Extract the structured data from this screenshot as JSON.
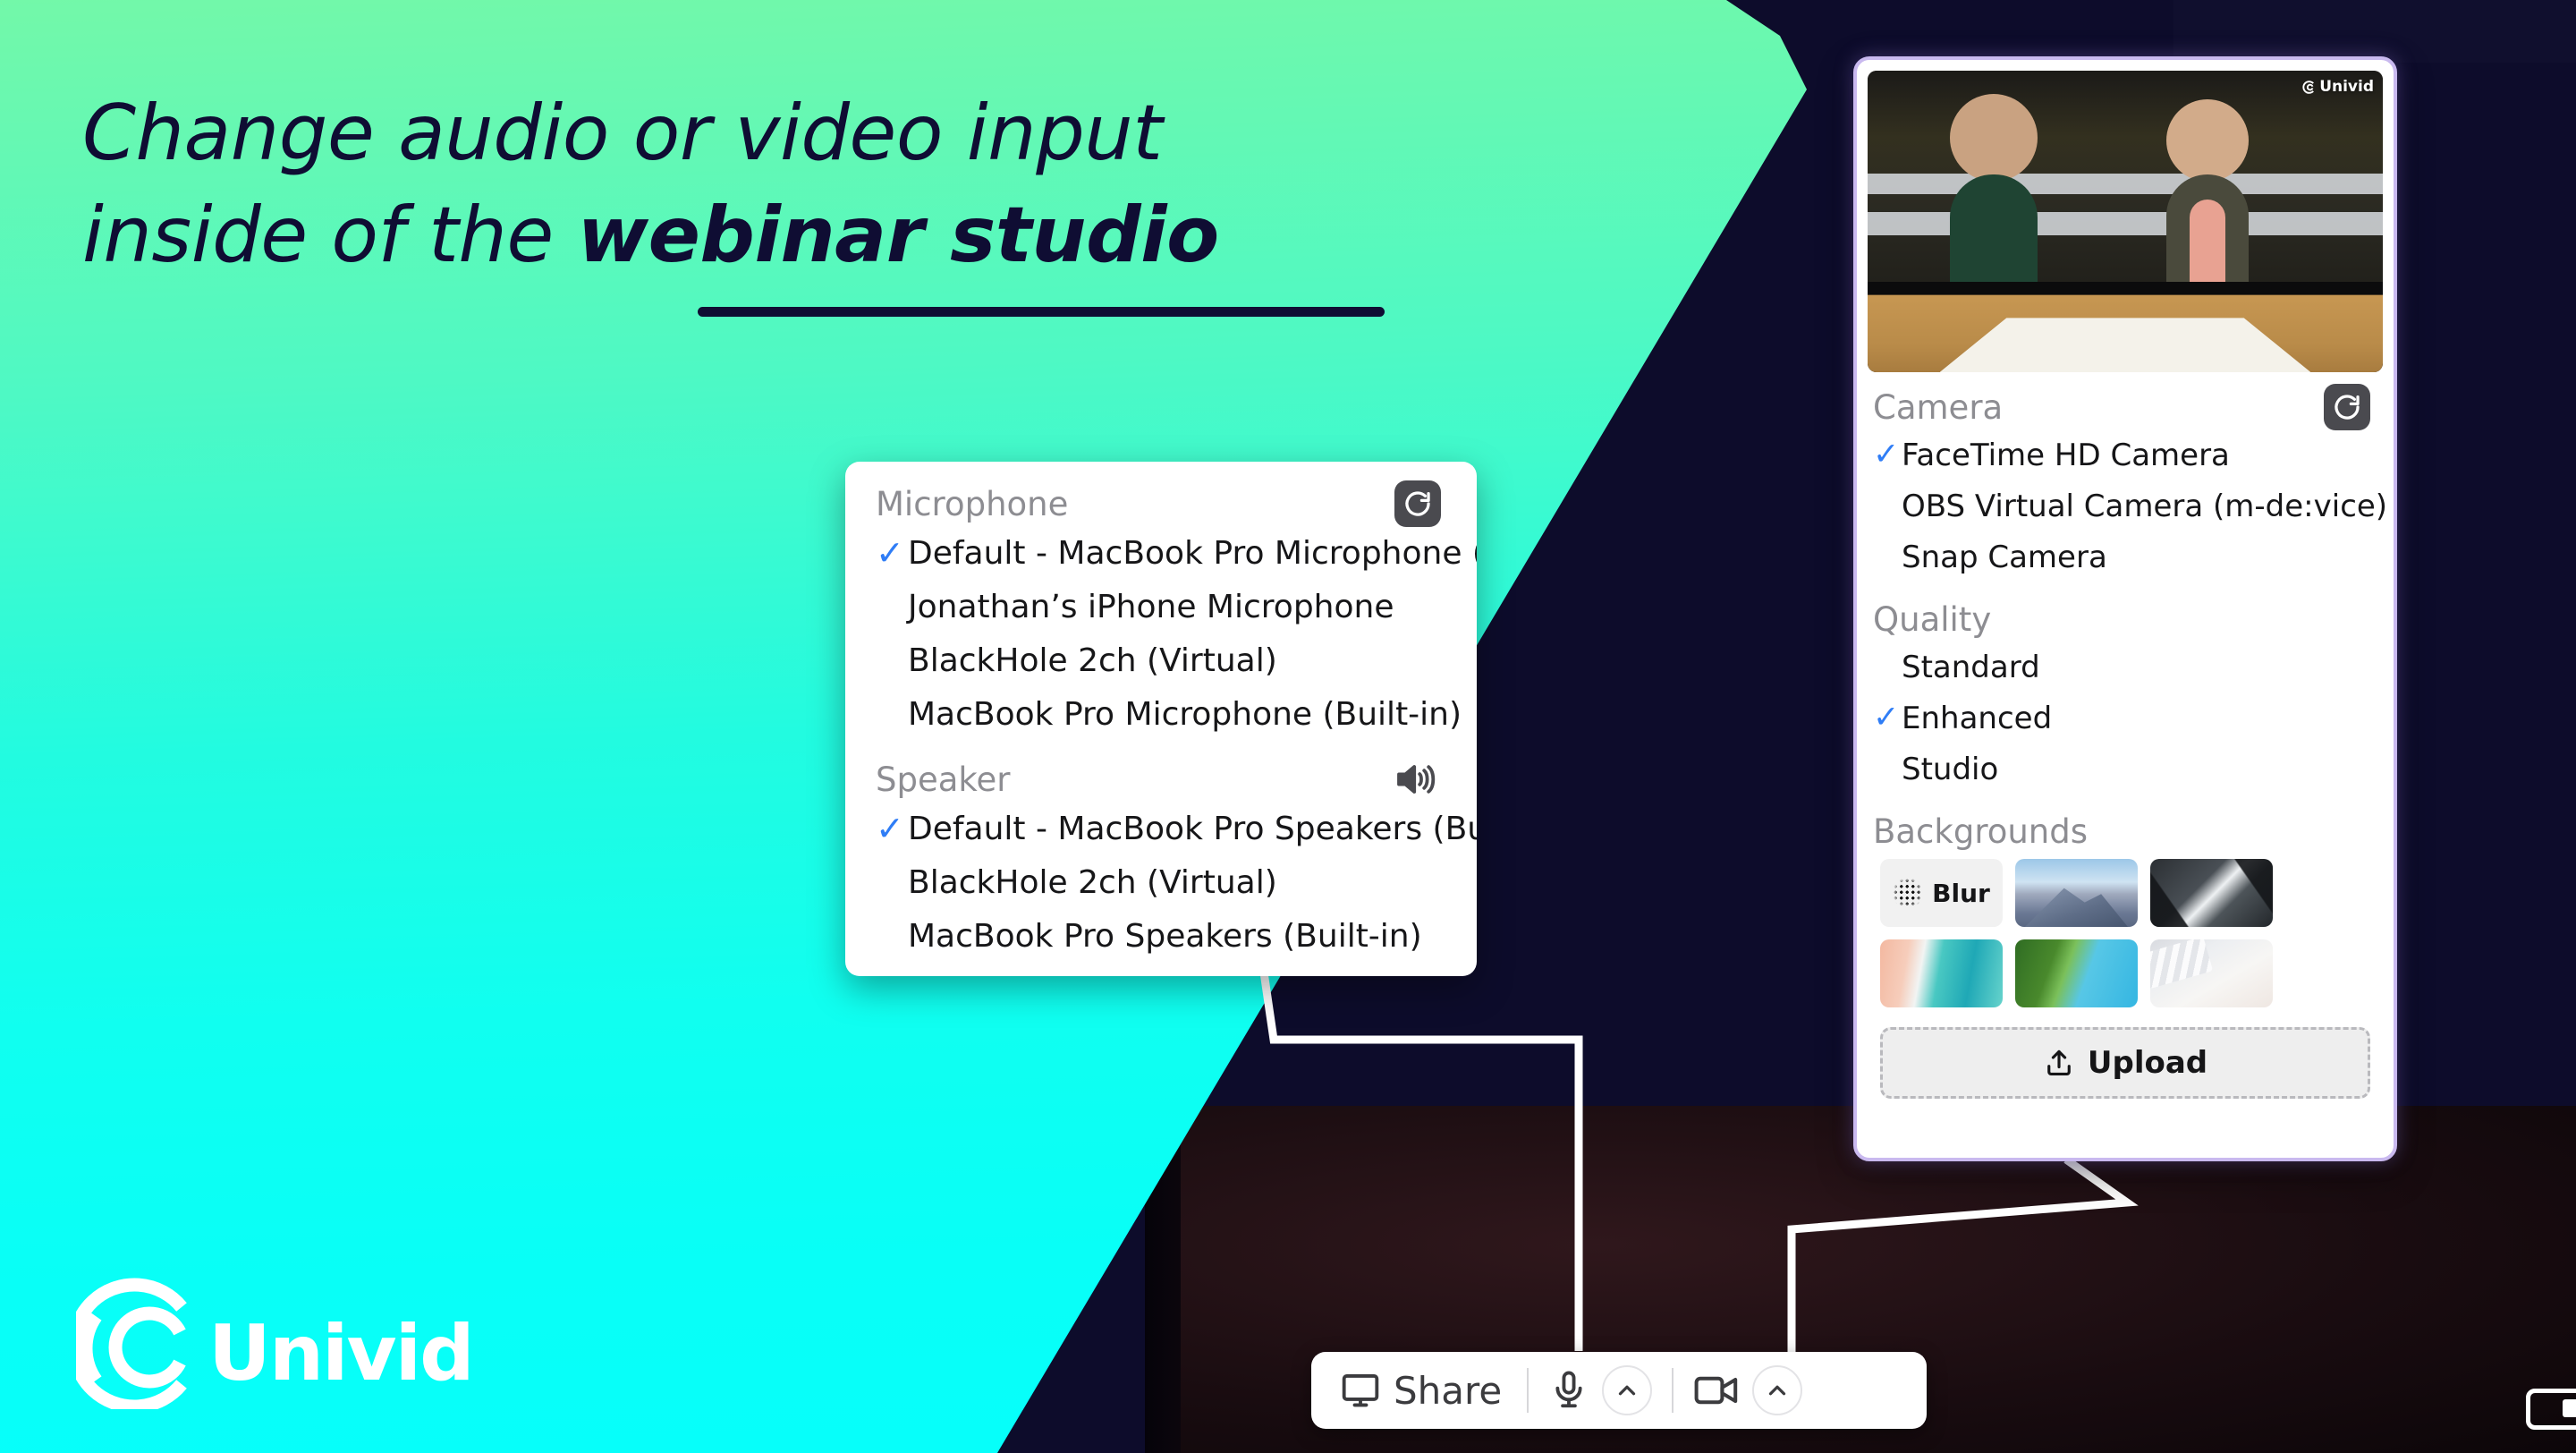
{
  "headline": {
    "line1": "Change audio or video input",
    "line2_plain": "inside of the ",
    "line2_bold": "webinar studio"
  },
  "brand": {
    "name": "Univid",
    "watermark": "Univid",
    "accent_green": "#4ef9c4",
    "accent_cyan": "#06fffb",
    "dark_navy": "#0d0c2b",
    "check_blue": "#2f7df6"
  },
  "audio_panel": {
    "microphone": {
      "title": "Microphone",
      "refresh_icon": "refresh-icon",
      "options": [
        {
          "label": "Default - MacBook Pro Microphone (Built-in)",
          "selected": true
        },
        {
          "label": "Jonathan’s iPhone Microphone",
          "selected": false
        },
        {
          "label": "BlackHole 2ch (Virtual)",
          "selected": false
        },
        {
          "label": "MacBook Pro Microphone (Built-in)",
          "selected": false
        }
      ]
    },
    "speaker": {
      "title": "Speaker",
      "test_icon": "speaker-icon",
      "options": [
        {
          "label": "Default - MacBook Pro Speakers (Built-in)",
          "selected": true
        },
        {
          "label": "BlackHole 2ch (Virtual)",
          "selected": false
        },
        {
          "label": "MacBook Pro Speakers (Built-in)",
          "selected": false
        }
      ]
    }
  },
  "video_panel": {
    "watermark": "Univid",
    "camera": {
      "title": "Camera",
      "refresh_icon": "refresh-icon",
      "options": [
        {
          "label": "FaceTime HD Camera",
          "selected": true
        },
        {
          "label": "OBS Virtual Camera (m-de:vice)",
          "selected": false
        },
        {
          "label": "Snap Camera",
          "selected": false
        }
      ]
    },
    "quality": {
      "title": "Quality",
      "options": [
        {
          "label": "Standard",
          "selected": false
        },
        {
          "label": "Enhanced",
          "selected": true
        },
        {
          "label": "Studio",
          "selected": false
        }
      ]
    },
    "backgrounds": {
      "title": "Backgrounds",
      "blur_label": "Blur",
      "thumbnails": [
        "blur",
        "mountain-snow",
        "city-skyscrapers",
        "ocean-shore",
        "lake-forest",
        "desk-keyboard"
      ],
      "upload_label": "Upload",
      "upload_icon": "upload-icon"
    }
  },
  "toolbar": {
    "share_label": "Share",
    "share_icon": "screen-share-icon",
    "mic_icon": "microphone-icon",
    "mic_caret_icon": "chevron-up-icon",
    "camera_icon": "video-camera-icon",
    "camera_caret_icon": "chevron-up-icon"
  }
}
